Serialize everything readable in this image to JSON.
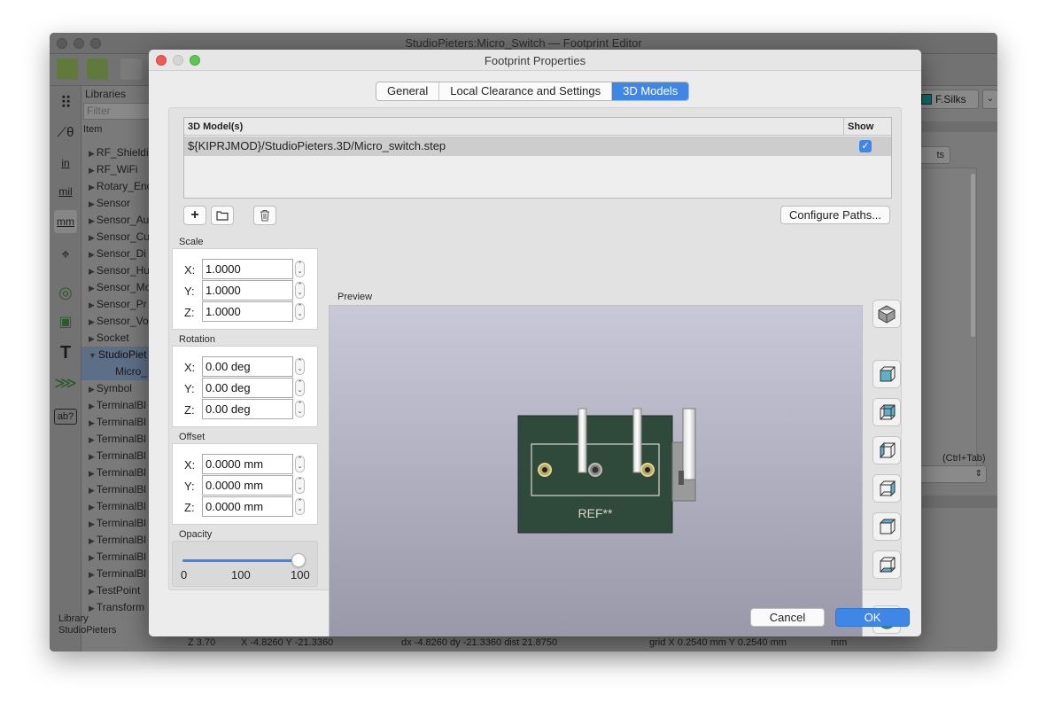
{
  "main_window": {
    "title": "StudioPieters:Micro_Switch — Footprint Editor",
    "libraries_header": "Libraries",
    "filter_placeholder": "Filter",
    "item_column": "Item",
    "libraries": [
      {
        "label": "RF_Shieldi"
      },
      {
        "label": "RF_WiFi"
      },
      {
        "label": "Rotary_Enc"
      },
      {
        "label": "Sensor"
      },
      {
        "label": "Sensor_Au"
      },
      {
        "label": "Sensor_Cu"
      },
      {
        "label": "Sensor_Di"
      },
      {
        "label": "Sensor_Hu"
      },
      {
        "label": "Sensor_Mo"
      },
      {
        "label": "Sensor_Pr"
      },
      {
        "label": "Sensor_Vo"
      },
      {
        "label": "Socket"
      },
      {
        "label": "StudioPiet",
        "selected": true
      },
      {
        "label": "Micro_",
        "child": true
      },
      {
        "label": "Symbol"
      },
      {
        "label": "TerminalBl"
      },
      {
        "label": "TerminalBl"
      },
      {
        "label": "TerminalBl"
      },
      {
        "label": "TerminalBl"
      },
      {
        "label": "TerminalBl"
      },
      {
        "label": "TerminalBl"
      },
      {
        "label": "TerminalBl"
      },
      {
        "label": "TerminalBl"
      },
      {
        "label": "TerminalBl"
      },
      {
        "label": "TerminalBl"
      },
      {
        "label": "TerminalBl"
      },
      {
        "label": "TestPoint"
      },
      {
        "label": "Transform"
      }
    ],
    "footer_line1": "Library",
    "footer_line2": "StudioPieters",
    "left_tools": [
      "grid-icon",
      "polar-icon",
      "in",
      "mil",
      "mm",
      "cursor-icon",
      "pad-icon",
      "footprint-icon",
      "text-icon",
      "route-icon",
      "ab?"
    ],
    "status": {
      "zoom": "Z 3.70",
      "xy": "X -4.8260  Y -21.3360",
      "delta": "dx -4.8260  dy -21.3360  dist 21.8750",
      "grid": "grid X 0.2540 mm  Y 0.2540 mm",
      "units": "mm"
    },
    "layer": "F.Silks",
    "layer_color": "#0b6e68",
    "ctrl_tab": "(Ctrl+Tab)",
    "ts_tab": "ts"
  },
  "dialog": {
    "title": "Footprint Properties",
    "tabs": [
      {
        "label": "General"
      },
      {
        "label": "Local Clearance and Settings"
      },
      {
        "label": "3D Models",
        "active": true
      }
    ],
    "table": {
      "col_model": "3D Model(s)",
      "col_show": "Show",
      "rows": [
        {
          "path": "${KIPRJMOD}/StudioPieters.3D/Micro_switch.step",
          "show": true
        }
      ]
    },
    "add_btn": "+",
    "configure_paths": "Configure Paths...",
    "scale": {
      "label": "Scale",
      "x": "1.0000",
      "y": "1.0000",
      "z": "1.0000"
    },
    "rotation": {
      "label": "Rotation",
      "x": "0.00 deg",
      "y": "0.00 deg",
      "z": "0.00 deg"
    },
    "offset": {
      "label": "Offset",
      "x": "0.0000 mm",
      "y": "0.0000 mm",
      "z": "0.0000 mm"
    },
    "axis_x": "X:",
    "axis_y": "Y:",
    "axis_z": "Z:",
    "opacity": {
      "label": "Opacity",
      "value": 100,
      "min_label": "0",
      "mid_label": "100",
      "max_label": "100"
    },
    "preview_label": "Preview",
    "ref_text": "REF**",
    "cancel": "Cancel",
    "ok": "OK",
    "accent": "#3f87e7"
  }
}
